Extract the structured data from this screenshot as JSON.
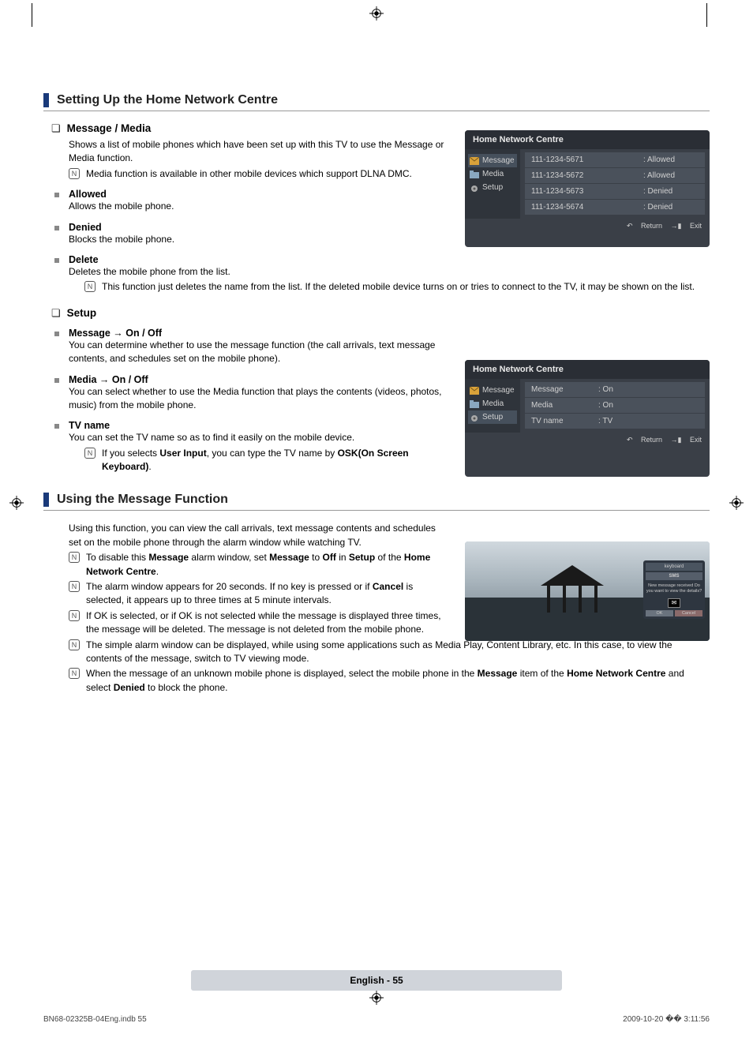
{
  "headings": {
    "section1": "Setting Up the Home Network Centre",
    "section2": "Using the Message Function"
  },
  "message_media": {
    "title": "Message / Media",
    "body": "Shows a list of mobile phones which have been set up with this TV to use the Message or Media function.",
    "note1": "Media function is available in other mobile devices which support DLNA DMC.",
    "allowed_title": "Allowed",
    "allowed_body": "Allows the mobile phone.",
    "denied_title": "Denied",
    "denied_body": "Blocks the mobile phone.",
    "delete_title": "Delete",
    "delete_body": "Deletes the mobile phone from the list.",
    "delete_note": "This function just deletes the name from the list. If the deleted mobile device turns on or tries to connect to the TV, it may be shown on the list."
  },
  "setup": {
    "title": "Setup",
    "msg_title": "Message → On / Off",
    "msg_body": "You can determine whether to use the message function (the call arrivals, text message contents, and schedules set on the mobile phone).",
    "media_title": "Media → On / Off",
    "media_body": "You can select whether to use the Media function that plays the contents (videos, photos, music) from the mobile phone.",
    "tvname_title": "TV name",
    "tvname_body": "You can set the TV name so as to find it easily on the mobile device.",
    "tvname_note_pre": "If you selects ",
    "tvname_note_bold1": "User Input",
    "tvname_note_mid": ", you can type the TV name by ",
    "tvname_note_bold2": "OSK(On Screen Keyboard)",
    "tvname_note_end": "."
  },
  "using_msg": {
    "intro": "Using this function, you can view the call arrivals, text message contents and schedules set on the mobile phone through the alarm window while watching TV.",
    "n1_pre": "To disable this ",
    "n1_b1": "Message",
    "n1_mid1": " alarm window, set ",
    "n1_b2": "Message",
    "n1_mid2": " to ",
    "n1_b3": "Off",
    "n1_mid3": " in ",
    "n1_b4": "Setup",
    "n1_mid4": " of the ",
    "n1_b5": "Home Network Centre",
    "n1_end": ".",
    "n2_pre": "The alarm window appears for 20 seconds. If no key is pressed or if ",
    "n2_b1": "Cancel",
    "n2_end": " is selected, it appears up to three times at 5 minute intervals.",
    "n3": "If OK is selected, or if OK is not selected while the message is displayed three times, the message will be deleted. The message is not deleted from the mobile phone.",
    "n4": "The simple alarm window can be displayed, while using some applications such as Media Play, Content Library, etc. In this case, to view the contents of the message, switch to TV viewing mode.",
    "n5_pre": "When the message of an unknown mobile phone is displayed, select the mobile phone in the ",
    "n5_b1": "Message",
    "n5_mid1": " item of the ",
    "n5_b2": "Home Network Centre",
    "n5_mid2": " and select ",
    "n5_b3": "Denied",
    "n5_end": " to block the phone."
  },
  "osd1": {
    "title": "Home Network Centre",
    "side": {
      "message": "Message",
      "media": "Media",
      "setup": "Setup"
    },
    "rows": [
      {
        "phone": "111-1234-5671",
        "status": ": Allowed"
      },
      {
        "phone": "111-1234-5672",
        "status": ": Allowed"
      },
      {
        "phone": "111-1234-5673",
        "status": ": Denied"
      },
      {
        "phone": "111-1234-5674",
        "status": ": Denied"
      }
    ],
    "footer_return": "Return",
    "footer_exit": "Exit"
  },
  "osd2": {
    "title": "Home Network Centre",
    "side": {
      "message": "Message",
      "media": "Media",
      "setup": "Setup"
    },
    "rows": [
      {
        "k": "Message",
        "v": ": On"
      },
      {
        "k": "Media",
        "v": ": On"
      },
      {
        "k": "TV name",
        "v": ": TV"
      }
    ],
    "footer_return": "Return",
    "footer_exit": "Exit"
  },
  "alarm": {
    "keyboard": "keyboard",
    "sms": "SMS",
    "msg": "New message received Do you want to view the details?",
    "ok": "OK",
    "cancel": "Cancel"
  },
  "footer": {
    "page": "English - 55",
    "doc": "BN68-02325B-04Eng.indb   55",
    "time": "2009-10-20   �� 3:11:56"
  }
}
